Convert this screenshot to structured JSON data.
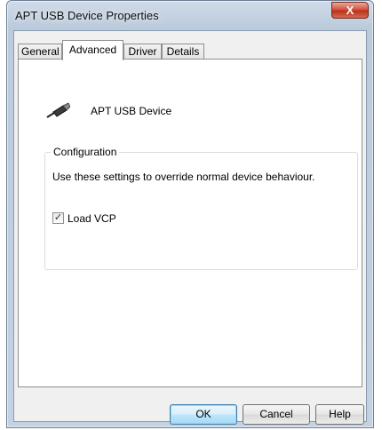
{
  "window": {
    "title": "APT USB Device Properties",
    "close_label": "X"
  },
  "tabs": [
    {
      "label": "General"
    },
    {
      "label": "Advanced"
    },
    {
      "label": "Driver"
    },
    {
      "label": "Details"
    }
  ],
  "active_tab": "Advanced",
  "device": {
    "name": "APT USB Device",
    "icon": "usb-plug-icon"
  },
  "configuration": {
    "title": "Configuration",
    "description": "Use these settings to override normal device behaviour.",
    "load_vcp": {
      "label": "Load VCP",
      "checked": true,
      "check_glyph": "✓"
    }
  },
  "buttons": {
    "ok": "OK",
    "cancel": "Cancel",
    "help": "Help"
  }
}
